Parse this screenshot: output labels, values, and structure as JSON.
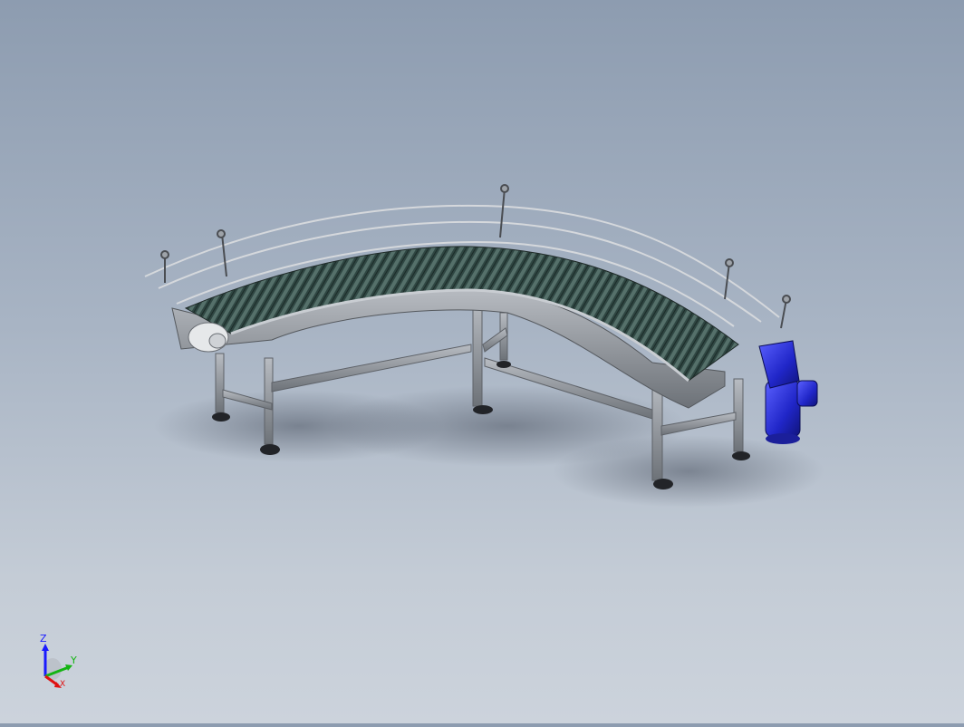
{
  "viewport": {
    "background_top": "#8d9cb0",
    "background_bottom": "#ccd3dc"
  },
  "model": {
    "frame_color": "#8a8e94",
    "belt_color": "#3f5a55",
    "motor_color": "#2a2fd0"
  },
  "triad": {
    "z_label": "Z",
    "y_label": "Y",
    "x_label": "X",
    "z_color": "#1a1aff",
    "y_color": "#14b414",
    "x_color": "#e01010"
  }
}
